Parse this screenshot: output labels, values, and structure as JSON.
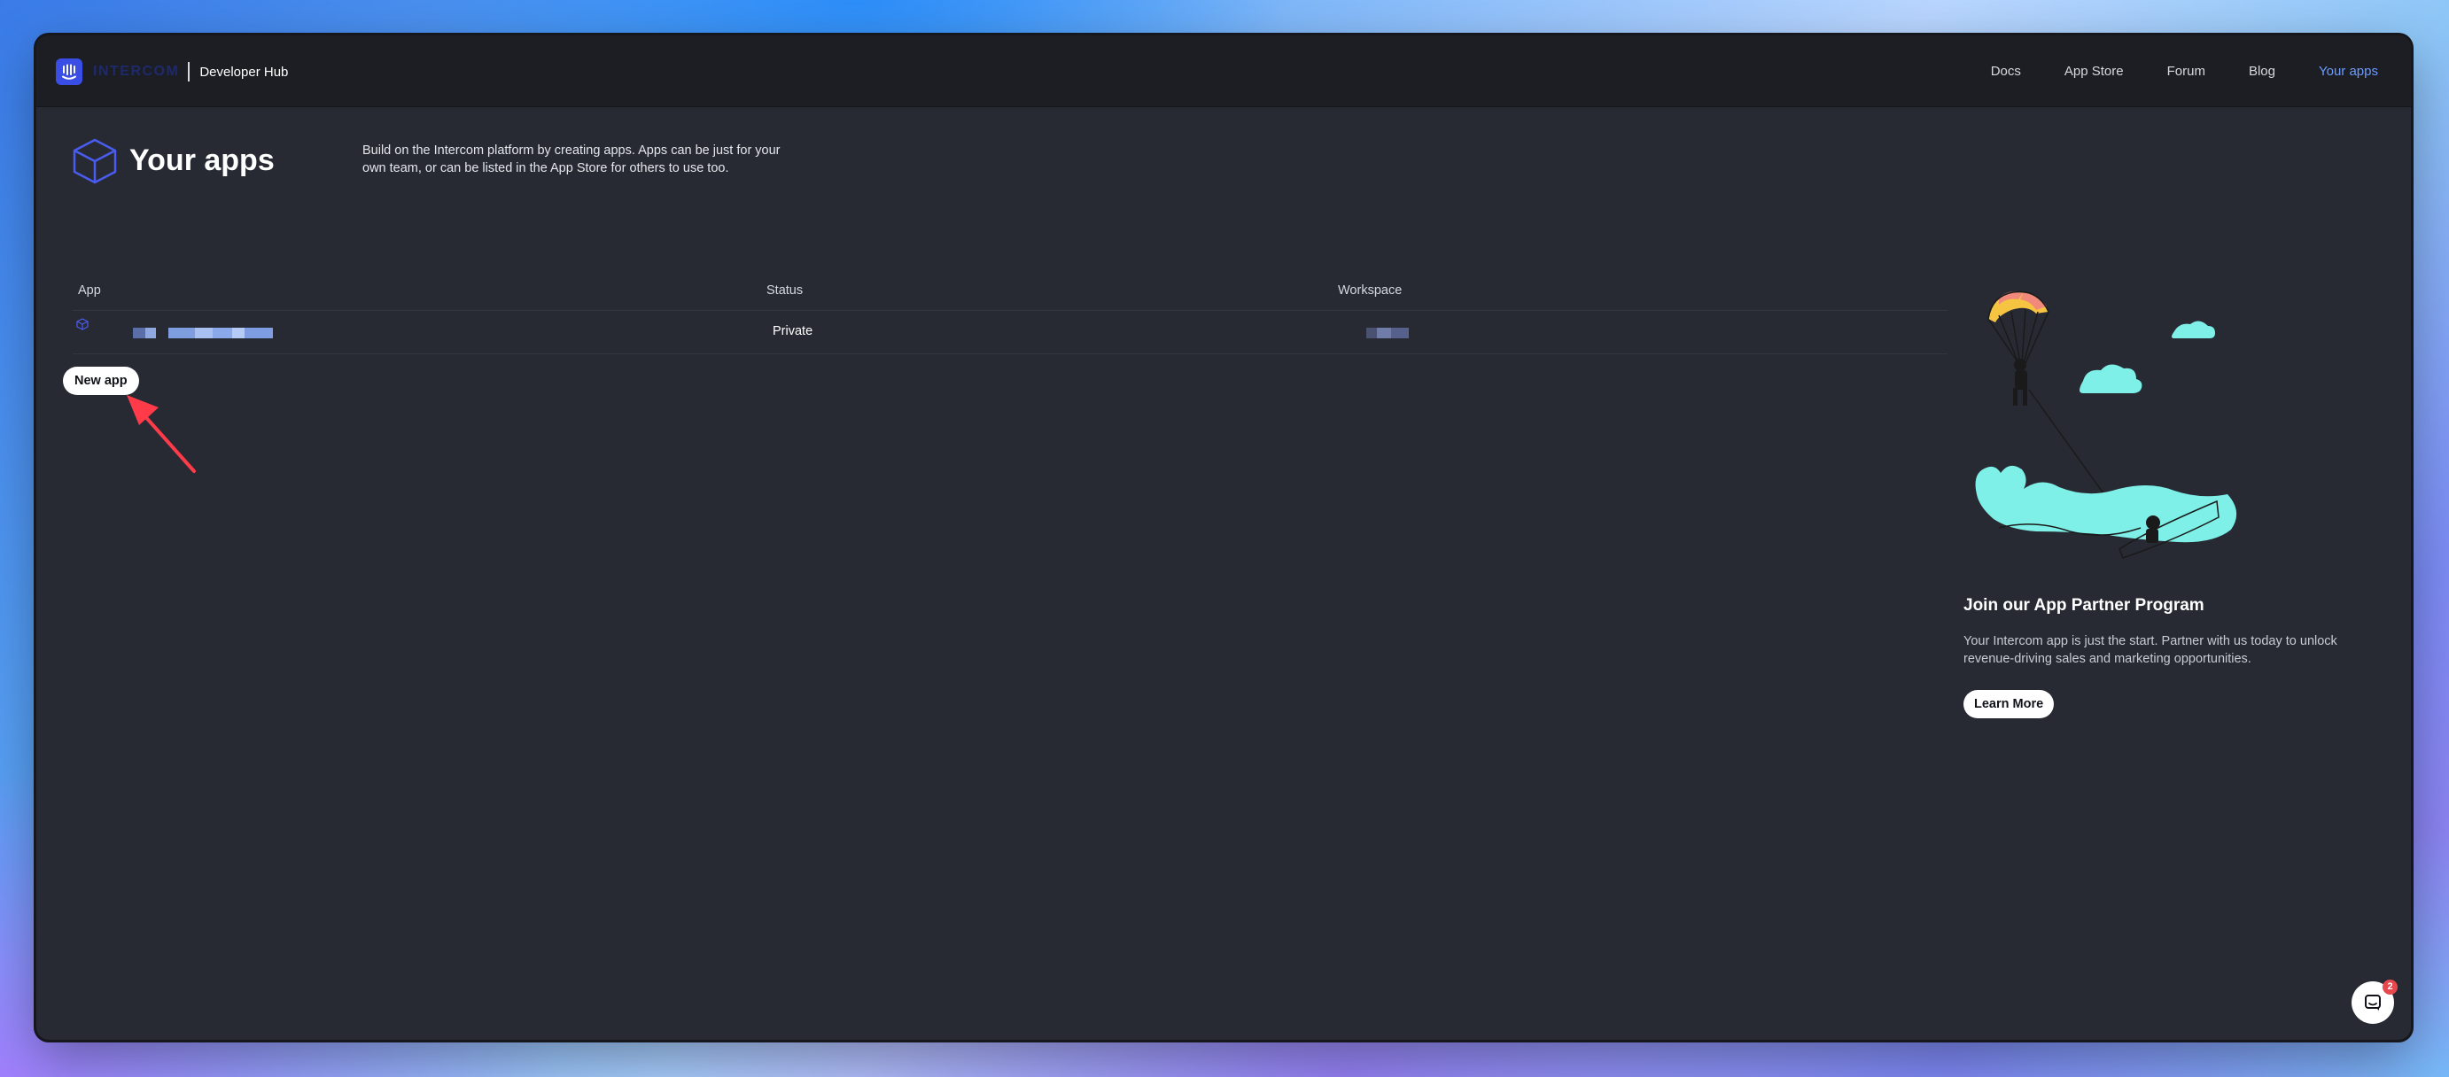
{
  "brand": {
    "wordmark": "INTERCOM",
    "subtitle": "Developer Hub",
    "logo_icon": "intercom-logo-icon",
    "accent_color": "#3a4ee6"
  },
  "nav": {
    "links": [
      {
        "label": "Docs"
      },
      {
        "label": "App Store"
      },
      {
        "label": "Forum"
      },
      {
        "label": "Blog"
      },
      {
        "label": "Your apps",
        "active": true
      }
    ],
    "active_color": "#6b9bff"
  },
  "page": {
    "title": "Your apps",
    "title_icon": "cube-icon",
    "intro": "Build on the Intercom platform by creating apps. Apps can be just for your own team, or can be listed in the App Store for others to use too."
  },
  "table": {
    "columns": [
      "App",
      "Status",
      "Workspace"
    ],
    "rows": [
      {
        "app": "",
        "app_redacted": true,
        "status": "Private",
        "workspace": "",
        "workspace_redacted": true
      }
    ]
  },
  "actions": {
    "new_app": "New app"
  },
  "promo": {
    "title": "Join our App Partner Program",
    "text": "Your Intercom app is just the start. Partner with us today to unlock revenue-driving sales and marketing opportunities.",
    "button": "Learn More",
    "illustration": "parasailing-illustration"
  },
  "messenger": {
    "icon": "chat-bubble-icon",
    "badge_count": "2"
  },
  "annotation": {
    "icon": "red-arrow-icon",
    "color": "#ff3b4a"
  }
}
